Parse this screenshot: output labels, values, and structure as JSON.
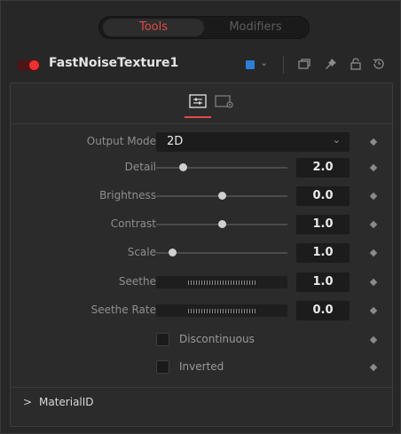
{
  "tabs": {
    "active": "Tools",
    "inactive": "Modifiers"
  },
  "node": {
    "name": "FastNoiseTexture1",
    "enabled": true,
    "color_chip": "#2a7fd6",
    "color_chevron": "⌄"
  },
  "header_icons": [
    "versions-icon",
    "pin-icon",
    "lock-icon",
    "reset-icon"
  ],
  "inspector_tabs": [
    "controls-tab-icon",
    "settings-tab-icon"
  ],
  "accent_color": "#e34a4a",
  "params": {
    "output_mode": {
      "label": "Output Mode",
      "value": "2D",
      "chevron": "⌄"
    },
    "detail": {
      "label": "Detail",
      "value": "2.0",
      "slider_fraction": 0.2
    },
    "brightness": {
      "label": "Brightness",
      "value": "0.0",
      "slider_fraction": 0.5
    },
    "contrast": {
      "label": "Contrast",
      "value": "1.0",
      "slider_fraction": 0.5
    },
    "scale": {
      "label": "Scale",
      "value": "1.0",
      "slider_fraction": 0.12
    },
    "seethe": {
      "label": "Seethe",
      "value": "1.0"
    },
    "seethe_rate": {
      "label": "Seethe Rate",
      "value": "0.0"
    },
    "discontinuous": {
      "label": "Discontinuous",
      "checked": false
    },
    "inverted": {
      "label": "Inverted",
      "checked": false
    }
  },
  "sections": [
    {
      "title": "MaterialID",
      "arrow": ">",
      "expanded": false
    }
  ]
}
